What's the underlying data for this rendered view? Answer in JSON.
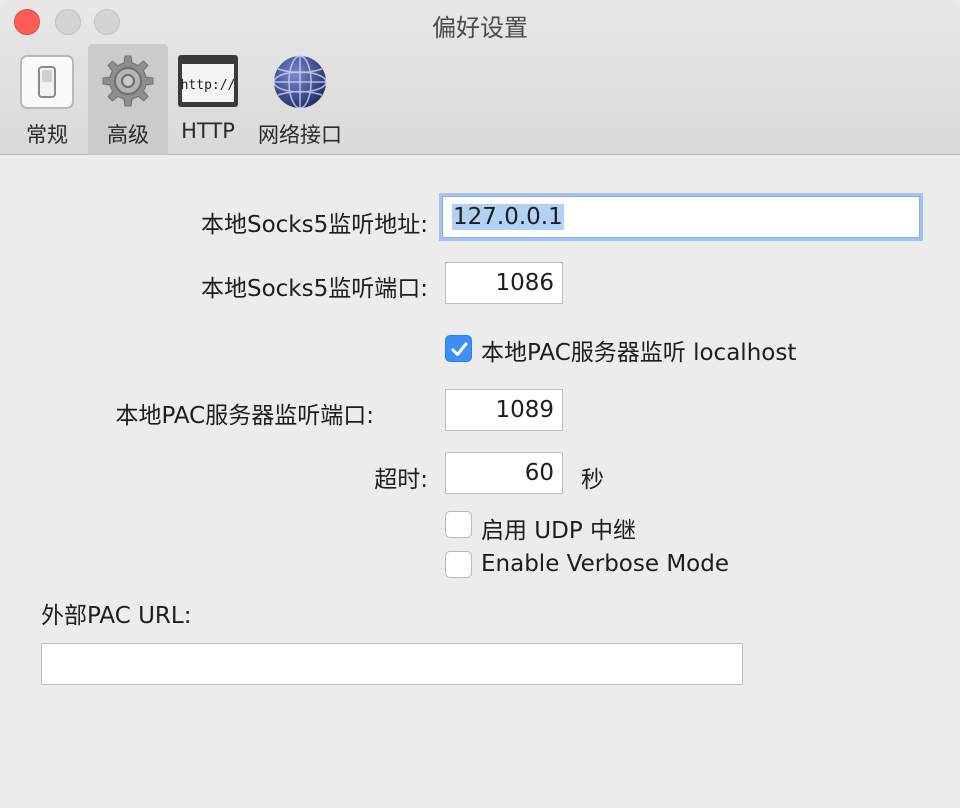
{
  "window": {
    "title": "偏好设置"
  },
  "toolbar": {
    "items": [
      {
        "label": "常规",
        "icon": "switch-icon"
      },
      {
        "label": "高级",
        "icon": "gear-icon",
        "active": true
      },
      {
        "label": "HTTP",
        "icon": "browser-icon"
      },
      {
        "label": "网络接口",
        "icon": "network-globe-icon"
      }
    ]
  },
  "form": {
    "socks_addr_label": "本地Socks5监听地址:",
    "socks_addr_value": "127.0.0.1",
    "socks_port_label": "本地Socks5监听端口:",
    "socks_port_value": "1086",
    "pac_localhost_label": "本地PAC服务器监听 localhost",
    "pac_localhost_checked": true,
    "pac_port_label": "本地PAC服务器监听端口:",
    "pac_port_value": "1089",
    "timeout_label": "超时:",
    "timeout_value": "60",
    "timeout_unit": "秒",
    "udp_relay_label": "启用 UDP 中继",
    "udp_relay_checked": false,
    "verbose_label": "Enable Verbose Mode",
    "verbose_checked": false,
    "external_pac_label": "外部PAC URL:",
    "external_pac_value": ""
  }
}
